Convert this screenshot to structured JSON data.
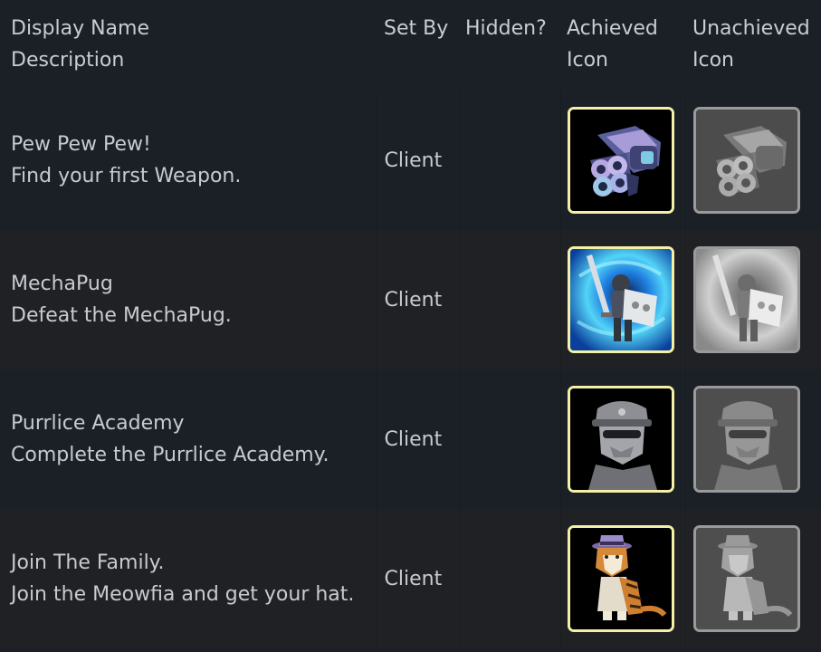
{
  "header": {
    "col_name_line1": "Display Name",
    "col_name_line2": "Description",
    "col_set_by": "Set By",
    "col_hidden": "Hidden?",
    "col_achieved_line1": "Achieved",
    "col_achieved_line2": "Icon",
    "col_unachieved_line1": "Unachieved",
    "col_unachieved_line2": "Icon"
  },
  "rows": [
    {
      "name": "Pew Pew Pew!",
      "description": "Find your first Weapon.",
      "set_by": "Client",
      "hidden": "",
      "icon": "multi-barrel-gun-icon"
    },
    {
      "name": "MechaPug",
      "description": "Defeat the MechaPug.",
      "set_by": "Client",
      "hidden": "",
      "icon": "armored-knight-vortex-icon"
    },
    {
      "name": "Purrlice Academy",
      "description": "Complete the Purrlice Academy.",
      "set_by": "Client",
      "hidden": "",
      "icon": "police-cat-bust-icon"
    },
    {
      "name": "Join The Family.",
      "description": "Join the Meowfia and get your hat.",
      "set_by": "Client",
      "hidden": "",
      "icon": "mafia-tiger-cat-icon"
    }
  ],
  "colors": {
    "background": "#1b2026",
    "row_alt": "#202124",
    "text": "#c7cbd1",
    "achieved_border": "#f4f1a6",
    "unachieved_border": "#9a9a9a"
  }
}
